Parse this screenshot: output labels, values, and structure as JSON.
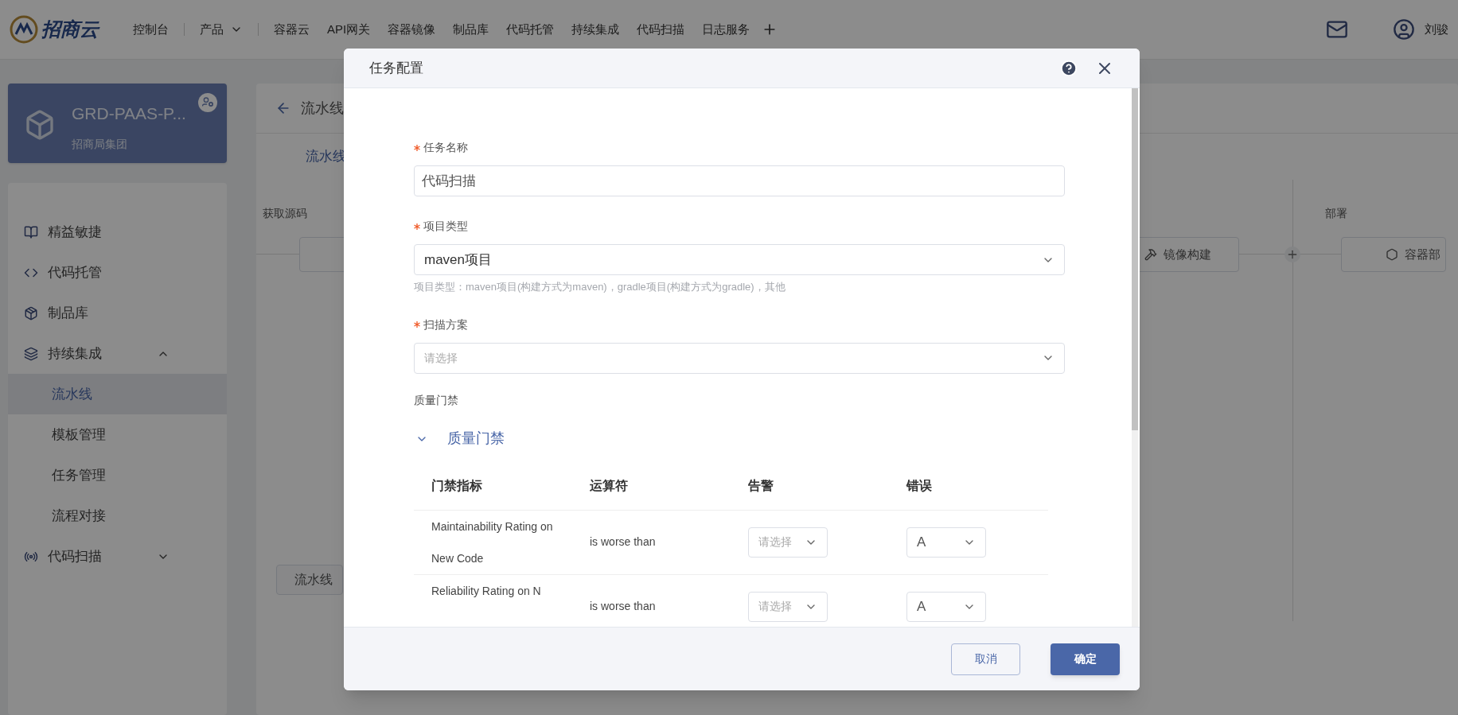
{
  "nav": {
    "logo": "招商云",
    "items": [
      {
        "label": "控制台",
        "kind": "link"
      },
      {
        "label": "产品",
        "kind": "dropdown"
      },
      {
        "label": "容器云",
        "kind": "link"
      },
      {
        "label": "API网关",
        "kind": "link"
      },
      {
        "label": "容器镜像",
        "kind": "link"
      },
      {
        "label": "制品库",
        "kind": "link"
      },
      {
        "label": "代码托管",
        "kind": "link"
      },
      {
        "label": "持续集成",
        "kind": "link"
      },
      {
        "label": "代码扫描",
        "kind": "link"
      },
      {
        "label": "日志服务",
        "kind": "link"
      }
    ],
    "user": "刘骏"
  },
  "sidebar": {
    "project": {
      "name": "GRD-PAAS-P...",
      "org": "招商局集团"
    },
    "menu": [
      {
        "label": "精益敏捷",
        "kind": "link"
      },
      {
        "label": "代码托管",
        "kind": "link"
      },
      {
        "label": "制品库",
        "kind": "link"
      },
      {
        "label": "持续集成",
        "kind": "group",
        "expanded": true,
        "children": [
          {
            "label": "流水线",
            "selected": true
          },
          {
            "label": "模板管理",
            "selected": false
          },
          {
            "label": "任务管理",
            "selected": false
          },
          {
            "label": "流程对接",
            "selected": false
          }
        ]
      },
      {
        "label": "代码扫描",
        "kind": "group",
        "expanded": false
      }
    ]
  },
  "page": {
    "title": "流水线",
    "tab": "流水线",
    "stages": [
      "获取源码",
      "部署"
    ],
    "nodes": [
      "镜像构建",
      "容器部"
    ],
    "bottom_button": "流水线"
  },
  "dialog": {
    "title": "任务配置",
    "fields": [
      {
        "label": "任务名称",
        "required": true,
        "kind": "input",
        "value": "代码扫描"
      },
      {
        "label": "项目类型",
        "required": true,
        "kind": "select",
        "value": "maven项目",
        "hint": "项目类型：maven项目(构建方式为maven)，gradle项目(构建方式为gradle)，其他"
      },
      {
        "label": "扫描方案",
        "required": true,
        "kind": "select",
        "placeholder": "请选择"
      }
    ],
    "quality_gate": {
      "label": "质量门禁",
      "panel": {
        "title": "质量门禁",
        "expanded": true,
        "columns": [
          "门禁指标",
          "运算符",
          "告警",
          "错误"
        ],
        "rows": [
          {
            "metric": "Maintainability Rating on New Code",
            "operator": "is worse than",
            "warning": {
              "placeholder": "请选择"
            },
            "error": {
              "value": "A"
            }
          },
          {
            "metric": "Reliability Rating on N",
            "operator": "is worse than",
            "warning": {
              "placeholder": "请选择"
            },
            "error": {
              "value": "A"
            }
          }
        ]
      }
    },
    "buttons": [
      {
        "label": "取消",
        "kind": "secondary"
      },
      {
        "label": "确定",
        "kind": "primary"
      }
    ]
  }
}
